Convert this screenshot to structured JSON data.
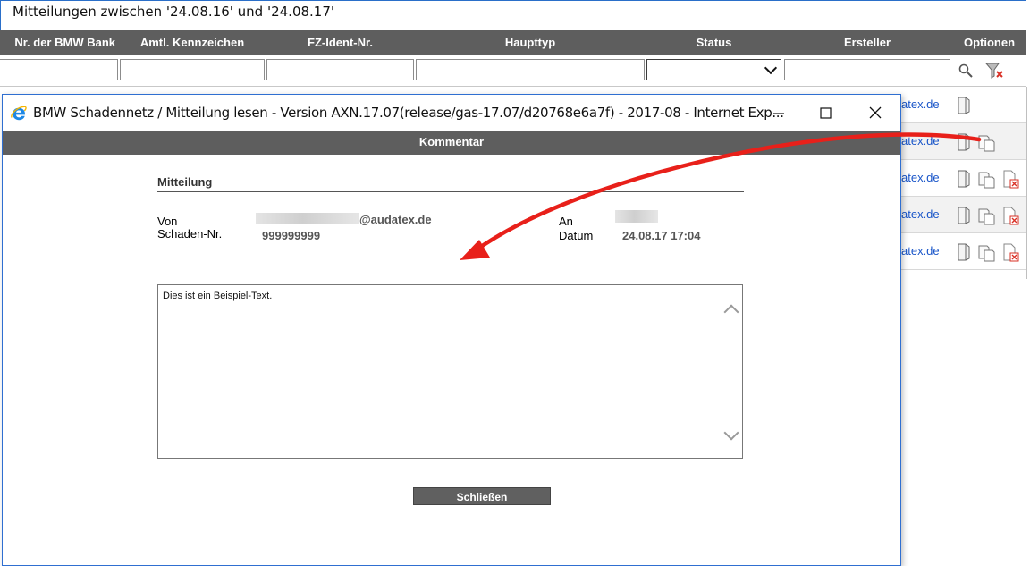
{
  "background": {
    "title": "Mitteilungen zwischen '24.08.16' und '24.08.17'",
    "columns": [
      "Nr. der BMW Bank",
      "Amtl. Kennzeichen",
      "FZ-Ident-Nr.",
      "Haupttyp",
      "Status",
      "Ersteller",
      "Optionen"
    ],
    "filter_icons": [
      "search-icon",
      "filter-clear-icon"
    ],
    "row_link_text": "atex.de",
    "rows": [
      {
        "link": "atex.de",
        "icons": [
          "read-icon"
        ]
      },
      {
        "link": "atex.de",
        "icons": [
          "read-icon",
          "comments-icon"
        ]
      },
      {
        "link": "atex.de",
        "icons": [
          "read-icon",
          "comments-icon",
          "delete-icon"
        ]
      },
      {
        "link": "atex.de",
        "icons": [
          "read-icon",
          "comments-icon",
          "delete-icon"
        ]
      },
      {
        "link": "atex.de",
        "icons": [
          "read-icon",
          "comments-icon",
          "delete-icon"
        ]
      }
    ]
  },
  "popup": {
    "window_title": "BMW Schadennetz / Mitteilung lesen - Version AXN.17.07(release/gas-17.07/d20768e6a7f) - 2017-08 - Internet Exp...",
    "header_bar": "Kommentar",
    "section_title": "Mitteilung",
    "labels": {
      "von": "Von",
      "schaden_nr": "Schaden-Nr.",
      "an": "An",
      "datum": "Datum"
    },
    "values": {
      "von_suffix": "@audatex.de",
      "schaden_nr": "999999999",
      "datum": "24.08.17 17:04"
    },
    "message_text": "Dies ist ein Beispiel-Text.",
    "close_button": "Schließen"
  },
  "colors": {
    "header_bar": "#5e5e5e",
    "window_border": "#2f6fd1",
    "link": "#1a56c9",
    "annotation_arrow": "#e8201a",
    "delete_icon": "#d93025"
  }
}
